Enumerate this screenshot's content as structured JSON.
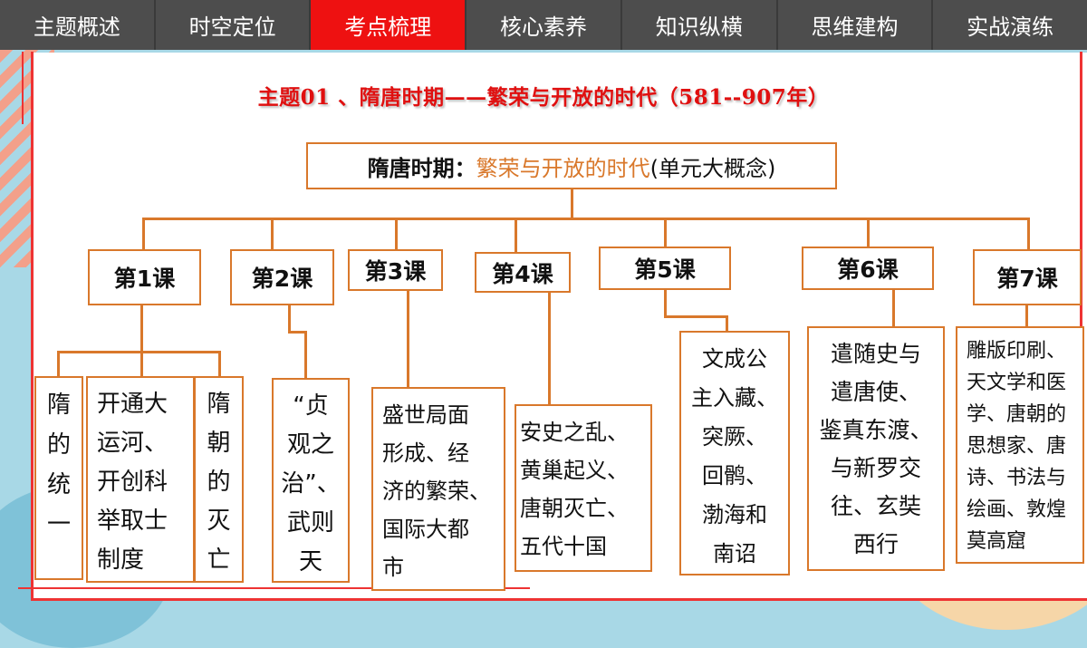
{
  "nav": {
    "tabs": [
      {
        "label": "主题概述",
        "active": false
      },
      {
        "label": "时空定位",
        "active": false
      },
      {
        "label": "考点梳理",
        "active": true
      },
      {
        "label": "核心素养",
        "active": false
      },
      {
        "label": "知识纵横",
        "active": false
      },
      {
        "label": "思维建构",
        "active": false
      },
      {
        "label": "实战演练",
        "active": false
      }
    ]
  },
  "title": "主题01 、隋唐时期——繁荣与开放的时代（581--907年）",
  "root": {
    "label": "隋唐时期：",
    "accent": "繁荣与开放的时代",
    "paren": "(单元大概念)"
  },
  "lessons": [
    {
      "label": "第1课"
    },
    {
      "label": "第2课"
    },
    {
      "label": "第3课"
    },
    {
      "label": "第4课"
    },
    {
      "label": "第5课"
    },
    {
      "label": "第6课"
    },
    {
      "label": "第7课"
    }
  ],
  "contents": {
    "l1a": "隋\n的\n统\n一",
    "l1b": "开通大\n运河、\n开创科\n举取士\n制度",
    "l1c": "隋\n朝\n的\n灭\n亡",
    "l2": "“贞\n观之\n治”、\n武则\n天",
    "l3": "盛世局面\n形成、经\n济的繁荣、\n国际大都\n市",
    "l4": "安史之乱、\n黄巢起义、\n唐朝灭亡、\n五代十国",
    "l5": "文成公\n主入藏、\n突厥、\n回鹘、\n渤海和\n南诏",
    "l6": "遣随史与\n遣唐使、\n鉴真东渡、\n与新罗交\n往、玄奘\n西行",
    "l7": "雕版印刷、\n天文学和医\n学、唐朝的\n思想家、唐\n诗、书法与\n绘画、敦煌\n莫高窟"
  },
  "colors": {
    "tab_bg": "#4d4d4d",
    "tab_active": "#ee1111",
    "accent_orange": "#d9782b",
    "title_red": "#e01010"
  }
}
